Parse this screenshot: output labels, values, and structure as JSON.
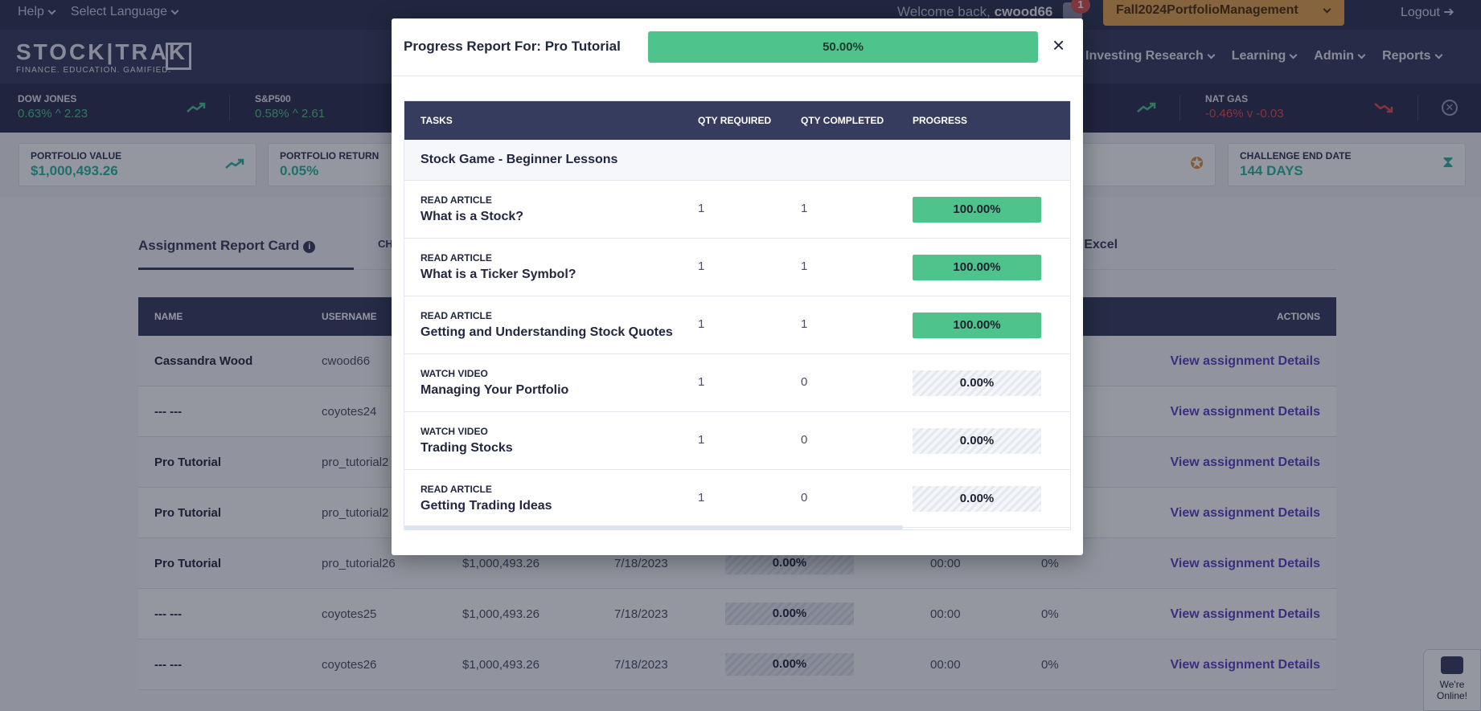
{
  "topbar": {
    "help": "Help",
    "language": "Select Language",
    "welcome_prefix": "Welcome back,",
    "username": "cwood66",
    "notification_count": "1",
    "portfolio": "Fall2024PortfolioManagement",
    "logout": "Logout"
  },
  "logo": {
    "word": "STOCK|TRAK",
    "tagline": "FINANCE. EDUCATION. GAMIFIED."
  },
  "nav": {
    "items": [
      "Investing Research",
      "Learning",
      "Admin",
      "Reports"
    ]
  },
  "ticker": [
    {
      "name": "DOW JONES",
      "value": "0.63% ^ 2.23",
      "trend": "up"
    },
    {
      "name": "S&P500",
      "value": "0.58% ^ 2.61",
      "trend": "up"
    },
    {
      "name": "NAT GAS",
      "value": "-0.46% v -0.03",
      "trend": "down"
    }
  ],
  "stats": {
    "portfolio_value": {
      "label": "PORTFOLIO VALUE",
      "value": "$1,000,493.26"
    },
    "portfolio_return": {
      "label": "PORTFOLIO RETURN",
      "value": "0.05%"
    },
    "challenge_end": {
      "label": "CHALLENGE END DATE",
      "value": "144 DAYS"
    }
  },
  "tabs": {
    "active": "Assignment Report Card",
    "second": "CH",
    "export": "o Excel"
  },
  "bg_table": {
    "headers": {
      "name": "NAME",
      "username": "USERNAME",
      "actions": "ACTIONS"
    },
    "rows": [
      {
        "name": "Cassandra Wood",
        "username": "cwood66",
        "value": "",
        "date": "",
        "progress": "",
        "time": "",
        "pct": "",
        "action": "View assignment Details"
      },
      {
        "name": "--- ---",
        "username": "coyotes24",
        "value": "",
        "date": "",
        "progress": "",
        "time": "",
        "pct": "",
        "action": "View assignment Details"
      },
      {
        "name": "Pro Tutorial",
        "username": "pro_tutorial2",
        "value": "",
        "date": "",
        "progress": "",
        "time": "",
        "pct": "",
        "action": "View assignment Details"
      },
      {
        "name": "Pro Tutorial",
        "username": "pro_tutorial2",
        "value": "",
        "date": "",
        "progress": "",
        "time": "",
        "pct": "",
        "action": "View assignment Details"
      },
      {
        "name": "Pro Tutorial",
        "username": "pro_tutorial26",
        "value": "$1,000,493.26",
        "date": "7/18/2023",
        "progress": "0.00%",
        "time": "00:00",
        "pct": "0%",
        "action": "View assignment Details"
      },
      {
        "name": "--- ---",
        "username": "coyotes25",
        "value": "$1,000,493.26",
        "date": "7/18/2023",
        "progress": "0.00%",
        "time": "00:00",
        "pct": "0%",
        "action": "View assignment Details"
      },
      {
        "name": "--- ---",
        "username": "coyotes26",
        "value": "$1,000,493.26",
        "date": "7/18/2023",
        "progress": "0.00%",
        "time": "00:00",
        "pct": "0%",
        "action": "View assignment Details"
      }
    ]
  },
  "modal": {
    "title": "Progress Report For: Pro Tutorial",
    "overall_progress": "50.00%",
    "close": "×",
    "headers": {
      "tasks": "TASKS",
      "qty_required": "QTY REQUIRED",
      "qty_completed": "QTY COMPLETED",
      "progress": "PROGRESS"
    },
    "section": "Stock Game - Beginner Lessons",
    "tasks": [
      {
        "type": "READ ARTICLE",
        "name": "What is a Stock?",
        "required": "1",
        "completed": "1",
        "progress": "100.00%",
        "fraction": 1.0
      },
      {
        "type": "READ ARTICLE",
        "name": "What is a Ticker Symbol?",
        "required": "1",
        "completed": "1",
        "progress": "100.00%",
        "fraction": 1.0
      },
      {
        "type": "READ ARTICLE",
        "name": "Getting and Understanding Stock Quotes",
        "required": "1",
        "completed": "1",
        "progress": "100.00%",
        "fraction": 1.0
      },
      {
        "type": "WATCH VIDEO",
        "name": "Managing Your Portfolio",
        "required": "1",
        "completed": "0",
        "progress": "0.00%",
        "fraction": 0.0
      },
      {
        "type": "WATCH VIDEO",
        "name": "Trading Stocks",
        "required": "1",
        "completed": "0",
        "progress": "0.00%",
        "fraction": 0.0
      },
      {
        "type": "READ ARTICLE",
        "name": "Getting Trading Ideas",
        "required": "1",
        "completed": "0",
        "progress": "0.00%",
        "fraction": 0.0
      }
    ]
  },
  "chat": {
    "label": "We're Online!"
  },
  "colors": {
    "accent_green": "#4ec48c",
    "navy": "#363c5e",
    "gold": "#e3a24c",
    "link_purple": "#5b3fc4"
  }
}
